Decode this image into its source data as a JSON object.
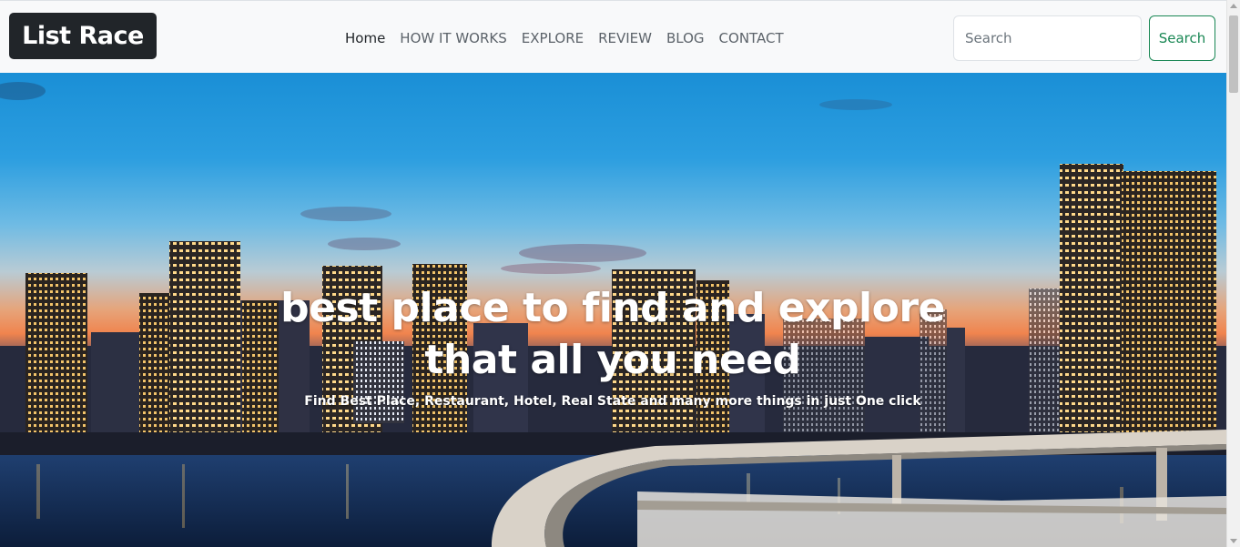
{
  "navbar": {
    "brand": "List Race",
    "links": [
      {
        "label": "Home",
        "active": true
      },
      {
        "label": "HOW IT WORKS",
        "active": false
      },
      {
        "label": "EXPLORE",
        "active": false
      },
      {
        "label": "REVIEW",
        "active": false
      },
      {
        "label": "BLOG",
        "active": false
      },
      {
        "label": "CONTACT",
        "active": false
      }
    ],
    "search": {
      "placeholder": "Search",
      "value": "",
      "button_label": "Search"
    }
  },
  "hero": {
    "title": "best place to find and explore that all you need",
    "subtitle": "Find Best Place, Restaurant, Hotel, Real State and many more things in just One click"
  },
  "colors": {
    "brand_bg": "#212529",
    "navbar_bg": "#f8f9fa",
    "search_button": "#198754"
  }
}
